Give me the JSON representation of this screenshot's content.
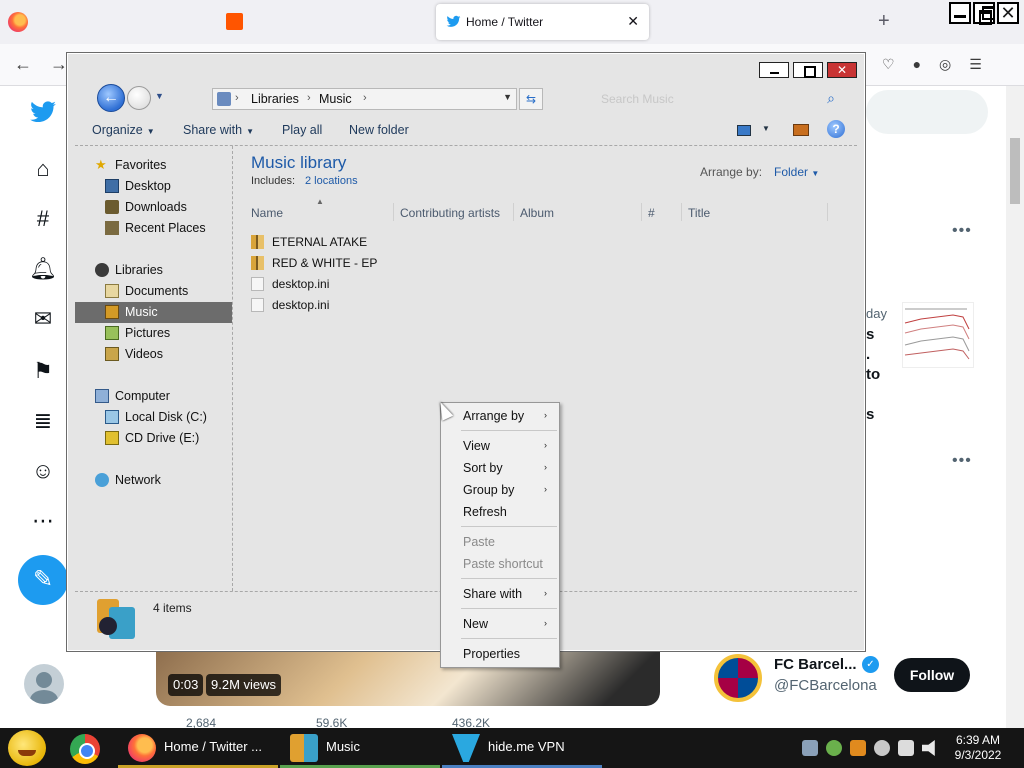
{
  "browser": {
    "active_tab_title": "Home / Twitter",
    "tab_close": "✕",
    "new_tab": "+"
  },
  "twitter": {
    "peek_day": "day",
    "peek_text_lines": [
      "s",
      ".",
      "to",
      "s"
    ],
    "video": {
      "time": "0:03",
      "views": "9.2M views"
    },
    "actions": {
      "replies": "2,684",
      "retweets": "59.6K",
      "likes": "436.2K"
    },
    "suggested": {
      "name": "FC Barcel...",
      "handle": "@FCBarcelona",
      "follow_label": "Follow"
    }
  },
  "explorer": {
    "breadcrumb": [
      "Libraries",
      "Music"
    ],
    "search_placeholder": "Search Music",
    "commands": {
      "organize": "Organize",
      "share_with": "Share with",
      "play_all": "Play all",
      "new_folder": "New folder"
    },
    "nav": {
      "favorites": "Favorites",
      "desktop": "Desktop",
      "downloads": "Downloads",
      "recent_places": "Recent Places",
      "libraries": "Libraries",
      "documents": "Documents",
      "music": "Music",
      "pictures": "Pictures",
      "videos": "Videos",
      "computer": "Computer",
      "local_disk": "Local Disk (C:)",
      "cd_drive": "CD Drive (E:)",
      "network": "Network"
    },
    "library": {
      "title": "Music library",
      "includes_label": "Includes:",
      "locations_link": "2 locations",
      "arrange_by_label": "Arrange by:",
      "arrange_by_value": "Folder"
    },
    "columns": [
      "Name",
      "Contributing artists",
      "Album",
      "#",
      "Title"
    ],
    "files": [
      {
        "name": "ETERNAL ATAKE",
        "type": "folder"
      },
      {
        "name": "RED & WHITE - EP",
        "type": "folder"
      },
      {
        "name": "desktop.ini",
        "type": "ini"
      },
      {
        "name": "desktop.ini",
        "type": "ini"
      }
    ],
    "status": "4 items"
  },
  "context_menu": {
    "arrange_by": "Arrange by",
    "view": "View",
    "sort_by": "Sort by",
    "group_by": "Group by",
    "refresh": "Refresh",
    "paste": "Paste",
    "paste_shortcut": "Paste shortcut",
    "share_with": "Share with",
    "new": "New",
    "properties": "Properties"
  },
  "taskbar": {
    "tasks": [
      {
        "label": "Home / Twitter ...",
        "underline": "#c9a227"
      },
      {
        "label": "Music",
        "underline": "#58a14e"
      },
      {
        "label": "hide.me VPN",
        "underline": "#4a7fc1"
      }
    ],
    "clock": {
      "time": "6:39 AM",
      "date": "9/3/2022"
    }
  }
}
